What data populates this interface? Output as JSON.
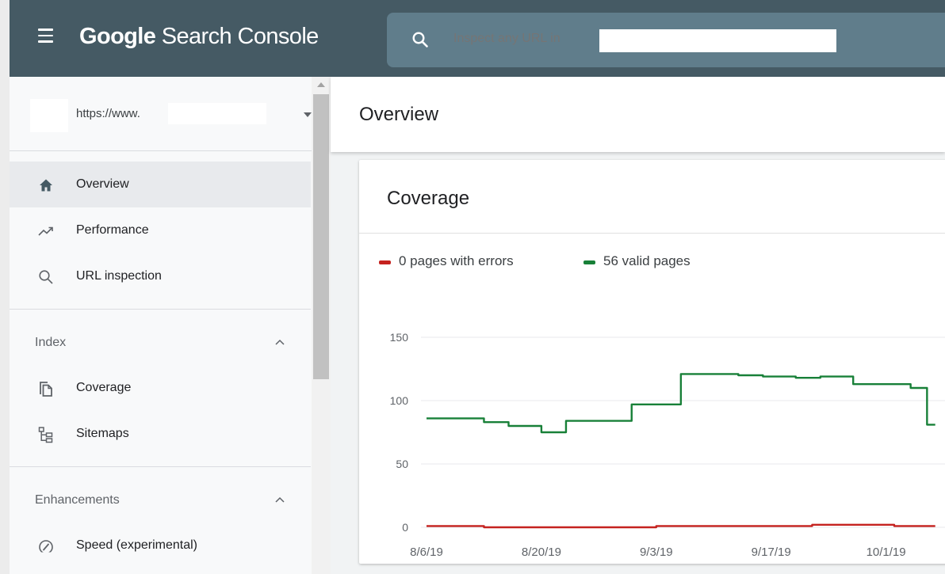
{
  "app": {
    "title_bold": "Google",
    "title_rest": " Search Console",
    "search_placeholder": "Inspect any URL in"
  },
  "property": {
    "url": "https://www."
  },
  "sidebar": {
    "items": [
      {
        "label": "Overview",
        "icon": "home-icon",
        "active": true
      },
      {
        "label": "Performance",
        "icon": "trending-up-icon"
      },
      {
        "label": "URL inspection",
        "icon": "search-icon"
      }
    ],
    "sections": [
      {
        "label": "Index",
        "items": [
          {
            "label": "Coverage",
            "icon": "copy-pages-icon"
          },
          {
            "label": "Sitemaps",
            "icon": "sitemap-icon"
          }
        ]
      },
      {
        "label": "Enhancements",
        "items": [
          {
            "label": "Speed (experimental)",
            "icon": "speed-gauge-icon"
          }
        ]
      }
    ]
  },
  "page": {
    "title": "Overview"
  },
  "card": {
    "title": "Coverage"
  },
  "colors": {
    "appbar": "#455a64",
    "error": "#c5221f",
    "valid": "#188038"
  },
  "chart_data": {
    "type": "line",
    "legend": [
      {
        "label": "0 pages with errors",
        "color": "#c5221f"
      },
      {
        "label": "56 valid pages",
        "color": "#188038"
      }
    ],
    "yticks": [
      150,
      100,
      50,
      0
    ],
    "ylim": [
      0,
      150
    ],
    "xticks": [
      "8/6/19",
      "8/20/19",
      "9/3/19",
      "9/17/19",
      "10/1/19"
    ],
    "x": [
      "8/6/19",
      "8/7/19",
      "8/8/19",
      "8/9/19",
      "8/10/19",
      "8/11/19",
      "8/12/19",
      "8/13/19",
      "8/14/19",
      "8/15/19",
      "8/16/19",
      "8/17/19",
      "8/18/19",
      "8/19/19",
      "8/20/19",
      "8/21/19",
      "8/22/19",
      "8/23/19",
      "8/24/19",
      "8/25/19",
      "8/26/19",
      "8/27/19",
      "8/28/19",
      "8/29/19",
      "8/30/19",
      "8/31/19",
      "9/1/19",
      "9/2/19",
      "9/3/19",
      "9/4/19",
      "9/5/19",
      "9/6/19",
      "9/7/19",
      "9/8/19",
      "9/9/19",
      "9/10/19",
      "9/11/19",
      "9/12/19",
      "9/13/19",
      "9/14/19",
      "9/15/19",
      "9/16/19",
      "9/17/19",
      "9/18/19",
      "9/19/19",
      "9/20/19",
      "9/21/19",
      "9/22/19",
      "9/23/19",
      "9/24/19",
      "9/25/19",
      "9/26/19",
      "9/27/19",
      "9/28/19",
      "9/29/19",
      "9/30/19",
      "10/1/19",
      "10/2/19",
      "10/3/19",
      "10/4/19",
      "10/5/19",
      "10/6/19",
      "10/7/19"
    ],
    "series": [
      {
        "name": "0 pages with errors",
        "color": "#c5221f",
        "values": [
          1,
          1,
          1,
          1,
          1,
          1,
          1,
          0,
          0,
          0,
          0,
          0,
          0,
          0,
          0,
          0,
          0,
          0,
          0,
          0,
          0,
          0,
          0,
          0,
          0,
          0,
          0,
          0,
          1,
          1,
          1,
          1,
          1,
          1,
          1,
          1,
          1,
          1,
          1,
          1,
          1,
          1,
          1,
          1,
          1,
          1,
          1,
          2,
          2,
          2,
          2,
          2,
          2,
          2,
          2,
          2,
          2,
          1,
          1,
          1,
          1,
          1,
          1
        ]
      },
      {
        "name": "56 valid pages",
        "color": "#188038",
        "values": [
          86,
          86,
          86,
          86,
          86,
          86,
          86,
          83,
          83,
          83,
          80,
          80,
          80,
          80,
          75,
          75,
          75,
          84,
          84,
          84,
          84,
          84,
          84,
          84,
          84,
          97,
          97,
          97,
          97,
          97,
          97,
          121,
          121,
          121,
          121,
          121,
          121,
          121,
          120,
          120,
          120,
          119,
          119,
          119,
          119,
          118,
          118,
          118,
          119,
          119,
          119,
          119,
          113,
          113,
          113,
          113,
          113,
          113,
          113,
          110,
          110,
          81,
          81
        ]
      }
    ]
  }
}
